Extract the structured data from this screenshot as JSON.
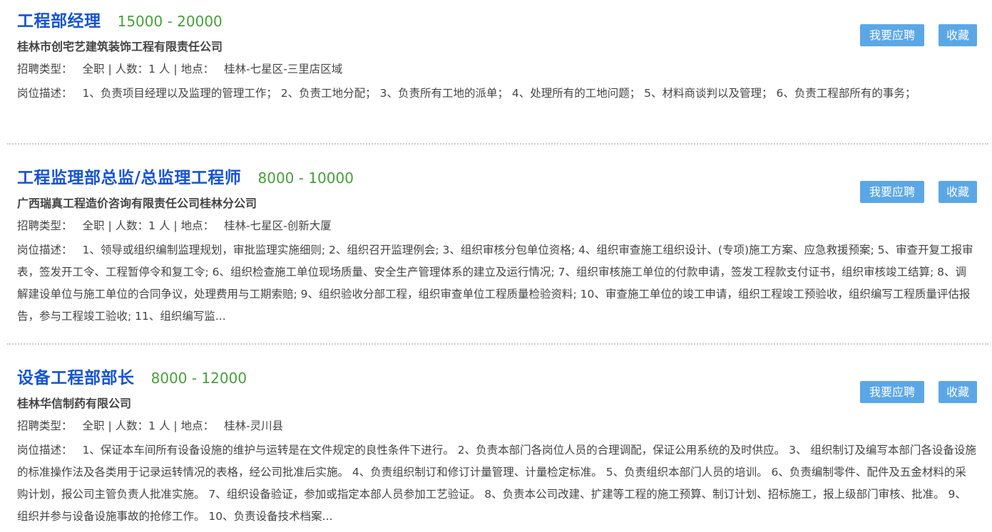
{
  "labels": {
    "type_label": "招聘类型：",
    "count_label": "人数：",
    "location_label": "地点：",
    "desc_label": "岗位描述：",
    "apply_button": "我要应聘",
    "fav_button": "收藏",
    "sep": "|"
  },
  "colors": {
    "title": "#1654d6",
    "salary": "#45a13a",
    "button": "#5ba7e6",
    "text": "#444444"
  },
  "jobs": [
    {
      "title": "工程部经理",
      "salary": "15000 - 20000",
      "company": "桂林市创宅艺建筑装饰工程有限责任公司",
      "type": "全职",
      "count": "1 人",
      "location": "桂林-七星区-三里店区域",
      "description": "1、负责项目经理以及监理的管理工作；  2、负责工地分配；  3、负责所有工地的派单；  4、处理所有的工地问题；  5、材料商谈判以及管理；  6、负责工程部所有的事务；"
    },
    {
      "title": "工程监理部总监/总监理工程师",
      "salary": "8000 - 10000",
      "company": "广西瑞真工程造价咨询有限责任公司桂林分公司",
      "type": "全职",
      "count": "1 人",
      "location": "桂林-七星区-创新大厦",
      "description": "1、领导或组织编制监理规划，审批监理实施细则; 2、组织召开监理例会; 3、组织审核分包单位资格; 4、组织审查施工组织设计、(专项)施工方案、应急救援预案; 5、审查开复工报审表，签发开工令、工程暂停令和复工令; 6、组织检查施工单位现场质量、安全生产管理体系的建立及运行情况; 7、组织审核施工单位的付款申请，签发工程款支付证书，组织审核竣工结算; 8、调解建设单位与施工单位的合同争议，处理费用与工期索赔; 9、组织验收分部工程，组织审查单位工程质量检验资料; 10、审查施工单位的竣工申请，组织工程竣工预验收，组织编写工程质量评估报告，参与工程竣工验收; 11、组织编写监..."
    },
    {
      "title": "设备工程部部长",
      "salary": "8000 - 12000",
      "company": "桂林华信制药有限公司",
      "type": "全职",
      "count": "1 人",
      "location": "桂林-灵川县",
      "description": "1、保证本车间所有设备设施的维护与运转是在文件规定的良性条件下进行。 2、负责本部门各岗位人员的合理调配，保证公用系统的及时供应。 3、 组织制订及编写本部门各设备设施的标准操作法及各类用于记录运转情况的表格，经公司批准后实施。 4、负责组织制订和修订计量管理、计量检定标准。 5、负责组织本部门人员的培训。 6、负责编制零件、配件及五金材料的采购计划，报公司主管负责人批准实施。 7、组织设备验证，参加或指定本部人员参加工艺验证。 8、负责本公司改建、扩建等工程的施工预算、制订计划、招标施工，报上级部门审核、批准。 9、组织并参与设备设施事故的抢修工作。 10、负责设备技术档案..."
    }
  ]
}
